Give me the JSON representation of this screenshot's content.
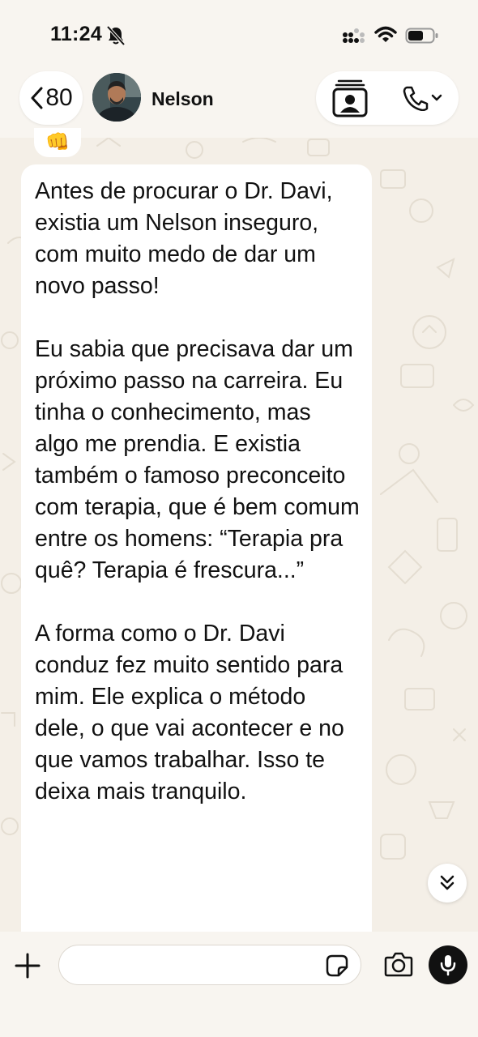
{
  "status_bar": {
    "time": "11:24",
    "bell_icon": "bell-slash-icon",
    "signal_icon": "cellular-signal-icon",
    "wifi_icon": "wifi-icon",
    "battery_icon": "battery-icon"
  },
  "header": {
    "back_count": "80",
    "contact_name": "Nelson",
    "back_icon": "chevron-left-icon",
    "contact_card_icon": "contact-card-icon",
    "call_icon": "phone-icon",
    "call_menu_icon": "chevron-down-icon"
  },
  "chat": {
    "reaction": "👊",
    "message_text": "Antes de procurar o Dr. Davi, existia um Nelson inseguro, com muito medo de dar um novo passo!\n\nEu sabia que precisava dar um próximo passo na carreira. Eu tinha o conhecimento, mas algo me prendia. E existia também o famoso preconceito com terapia, que é bem comum entre os homens: “Terapia pra quê? Terapia é frescura...”\n\nA forma como o Dr. Davi conduz fez muito sentido para mim. Ele explica o método dele, o que vai acontecer e no que vamos trabalhar. Isso te deixa mais tranquilo.",
    "scroll_icon": "double-chevron-down-icon"
  },
  "input_bar": {
    "message_value": "",
    "plus_icon": "plus-icon",
    "sticker_icon": "sticker-icon",
    "camera_icon": "camera-icon",
    "mic_icon": "microphone-icon"
  },
  "colors": {
    "background": "#f4efe7",
    "bubble": "#ffffff",
    "text": "#111111",
    "mic_button": "#111111"
  }
}
